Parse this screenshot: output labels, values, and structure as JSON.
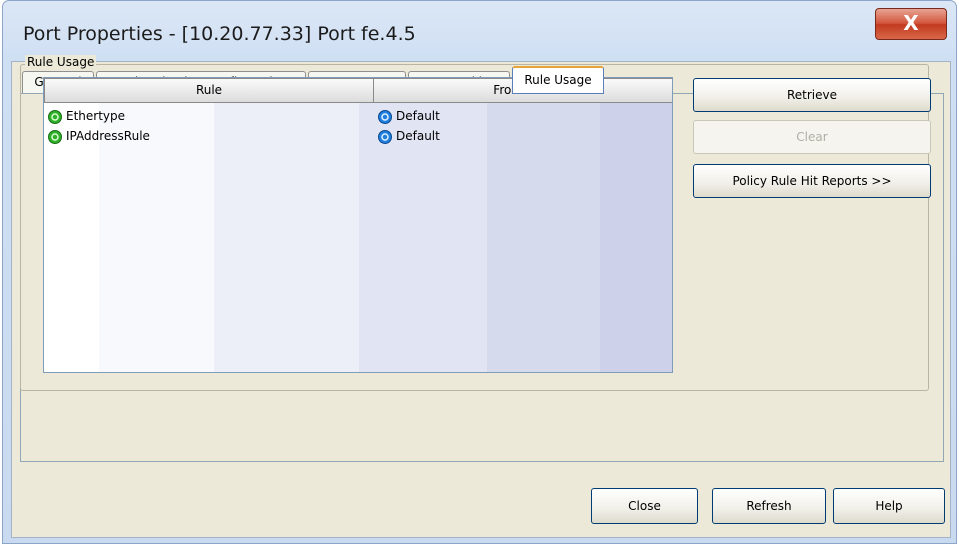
{
  "window": {
    "title": "Port Properties - [10.20.77.33] Port fe.4.5",
    "close_glyph": "X"
  },
  "tabs": [
    {
      "label": "General",
      "active": false
    },
    {
      "label": "Authentication Configuration",
      "active": false
    },
    {
      "label": "Port Usage",
      "active": false
    },
    {
      "label": "MAC Locking",
      "active": false
    },
    {
      "label": "Rule Usage",
      "active": true
    }
  ],
  "group": {
    "label": "Rule Usage"
  },
  "table": {
    "columns": [
      "Rule",
      "From Role"
    ],
    "rows": [
      {
        "rule": "Ethertype",
        "rule_icon": "green-rule-icon",
        "role": "Default",
        "role_icon": "blue-role-icon"
      },
      {
        "rule": "IPAddressRule",
        "rule_icon": "green-rule-icon",
        "role": "Default",
        "role_icon": "blue-role-icon"
      }
    ]
  },
  "side_buttons": {
    "retrieve": "Retrieve",
    "clear": "Clear",
    "hit_reports": "Policy Rule Hit Reports >>"
  },
  "footer_buttons": {
    "close": "Close",
    "refresh": "Refresh",
    "help": "Help"
  },
  "colors": {
    "rule_icon": "#2fb02a",
    "role_icon": "#1e7fe0",
    "close_button": "#c9432a"
  }
}
